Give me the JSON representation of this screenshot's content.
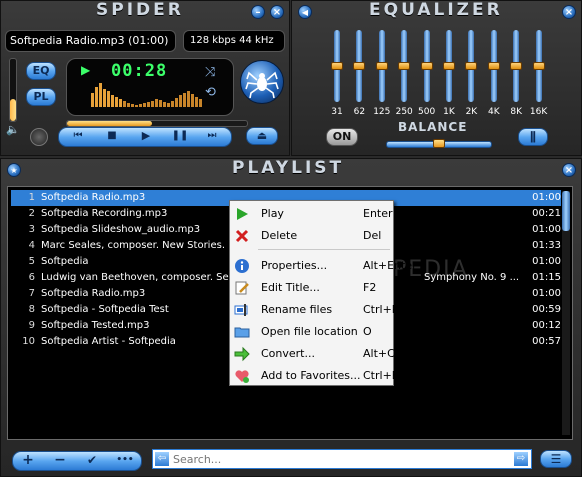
{
  "player": {
    "title": "SPIDER",
    "track_display": "Softpedia Radio.mp3 (01:00)",
    "bitrate": "128 kbps 44 kHz",
    "eq_button": "EQ",
    "pl_button": "PL",
    "time": "00:28",
    "minimize_icon": "minus-icon",
    "close_icon": "close-icon",
    "volume_level": 0.35,
    "position_level": 0.47
  },
  "equalizer": {
    "title": "EQUALIZER",
    "bands": [
      {
        "label": "31",
        "level": 0.5
      },
      {
        "label": "62",
        "level": 0.5
      },
      {
        "label": "125",
        "level": 0.5
      },
      {
        "label": "250",
        "level": 0.5
      },
      {
        "label": "500",
        "level": 0.5
      },
      {
        "label": "1K",
        "level": 0.5
      },
      {
        "label": "2K",
        "level": 0.5
      },
      {
        "label": "4K",
        "level": 0.5
      },
      {
        "label": "8K",
        "level": 0.5
      },
      {
        "label": "16K",
        "level": 0.5
      }
    ],
    "on_button": "ON",
    "balance_label": "BALANCE",
    "balance_level": 0.5
  },
  "playlist": {
    "title": "PLAYLIST",
    "rows": [
      {
        "num": "1",
        "title": "Softpedia Radio.mp3",
        "time": "01:00",
        "selected": true
      },
      {
        "num": "2",
        "title": "Softpedia Recording.mp3",
        "time": "00:21"
      },
      {
        "num": "3",
        "title": "Softpedia Slideshow_audio.mp3",
        "time": "01:00"
      },
      {
        "num": "4",
        "title": "Marc Seales, composer. New Stories. Ern",
        "time": "01:33"
      },
      {
        "num": "5",
        "title": "Softpedia",
        "time": "01:00"
      },
      {
        "num": "6",
        "title": "Ludwig van Beethoven, composer. Seattl",
        "extra": "Symphony No. 9 ...",
        "time": "01:15"
      },
      {
        "num": "7",
        "title": "Softpedia Radio.mp3",
        "time": "01:00"
      },
      {
        "num": "8",
        "title": "Softpedia - Softpedia Test",
        "time": "00:59"
      },
      {
        "num": "9",
        "title": "Softpedia Tested.mp3",
        "time": "00:12"
      },
      {
        "num": "10",
        "title": "Softpedia Artist - Softpedia",
        "time": "00:57"
      }
    ],
    "search_placeholder": "Search...",
    "add_label": "+",
    "remove_label": "−",
    "check_label": "✔",
    "more_label": "•••",
    "watermark": "SOFTPEDIA"
  },
  "context_menu": {
    "items": [
      {
        "label": "Play",
        "shortcut": "Enter",
        "icon": "play-icon"
      },
      {
        "label": "Delete",
        "shortcut": "Del",
        "icon": "delete-icon"
      },
      {
        "label": "Properties...",
        "shortcut": "Alt+Enter",
        "icon": "info-icon"
      },
      {
        "label": "Edit Title...",
        "shortcut": "F2",
        "icon": "edit-icon"
      },
      {
        "label": "Rename files",
        "shortcut": "Ctrl+R",
        "icon": "rename-icon"
      },
      {
        "label": "Open file location",
        "shortcut": "O",
        "icon": "folder-icon"
      },
      {
        "label": "Convert...",
        "shortcut": "Alt+C",
        "icon": "convert-icon"
      },
      {
        "label": "Add to Favorites...",
        "shortcut": "Ctrl+B",
        "icon": "heart-icon"
      }
    ]
  },
  "colors": {
    "accent_blue": "#2c7bd4",
    "lcd_green": "#3cff6a",
    "spectrum_orange": "#e8a23a",
    "selection": "#2f7fd6"
  }
}
